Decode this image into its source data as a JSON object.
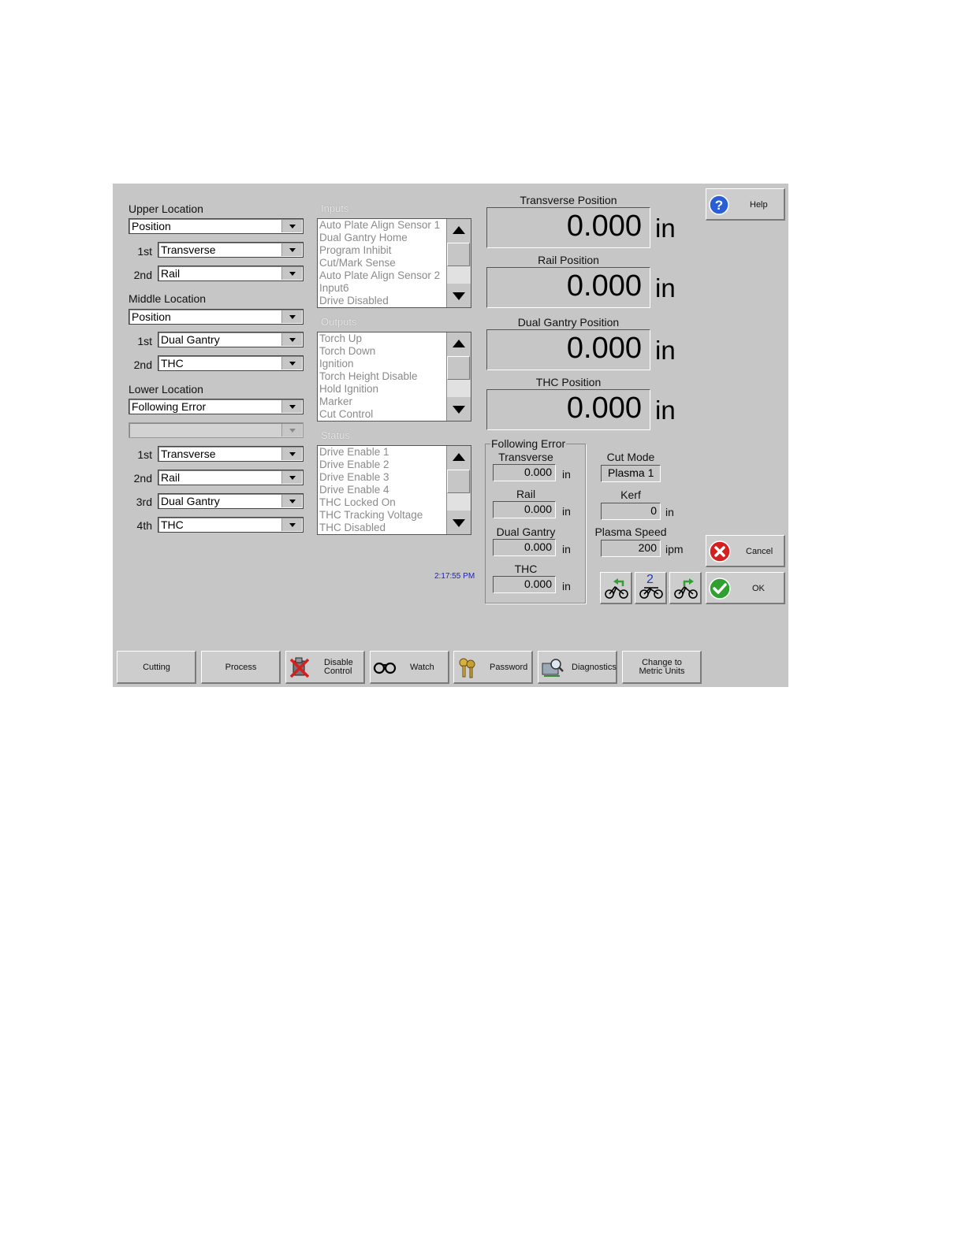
{
  "left": {
    "upper_label": "Upper Location",
    "upper_select": "Position",
    "upper_1st_label": "1st",
    "upper_1st": "Transverse",
    "upper_2nd_label": "2nd",
    "upper_2nd": "Rail",
    "middle_label": "Middle Location",
    "middle_select": "Position",
    "middle_1st_label": "1st",
    "middle_1st": "Dual Gantry",
    "middle_2nd_label": "2nd",
    "middle_2nd": "THC",
    "lower_label": "Lower Location",
    "lower_select": "Following Error",
    "lower_blank": "",
    "lower_1st_label": "1st",
    "lower_1st": "Transverse",
    "lower_2nd_label": "2nd",
    "lower_2nd": "Rail",
    "lower_3rd_label": "3rd",
    "lower_3rd": "Dual Gantry",
    "lower_4th_label": "4th",
    "lower_4th": "THC"
  },
  "inputs": {
    "label": "Inputs",
    "items": [
      "Auto Plate Align Sensor 1",
      "Dual Gantry Home",
      "Program Inhibit",
      "Cut/Mark Sense",
      "Auto Plate Align Sensor 2",
      "Input6",
      "Drive Disabled"
    ]
  },
  "outputs": {
    "label": "Outputs",
    "items": [
      "Torch Up",
      "Torch Down",
      "Ignition",
      "Torch Height Disable",
      "Hold Ignition",
      "Marker",
      "Cut Control"
    ]
  },
  "status": {
    "label": "Status",
    "items": [
      "Drive Enable 1",
      "Drive Enable 2",
      "Drive Enable 3",
      "Drive Enable 4",
      "THC Locked On",
      "THC Tracking Voltage",
      "THC Disabled"
    ]
  },
  "time": "2:17:55 PM",
  "positions": {
    "unit": "in",
    "transverse_label": "Transverse Position",
    "transverse_value": "0.000",
    "rail_label": "Rail Position",
    "rail_value": "0.000",
    "dual_label": "Dual Gantry Position",
    "dual_value": "0.000",
    "thc_label": "THC Position",
    "thc_value": "0.000"
  },
  "following_error": {
    "title": "Following Error",
    "unit": "in",
    "transverse_label": "Transverse",
    "transverse_value": "0.000",
    "rail_label": "Rail",
    "rail_value": "0.000",
    "dual_label": "Dual Gantry",
    "dual_value": "0.000",
    "thc_label": "THC",
    "thc_value": "0.000"
  },
  "cut": {
    "mode_label": "Cut Mode",
    "mode_value": "Plasma 1",
    "kerf_label": "Kerf",
    "kerf_value": "0",
    "kerf_unit": "in",
    "speed_label": "Plasma Speed",
    "speed_value": "200",
    "speed_unit": "ipm"
  },
  "buttons": {
    "help": "Help",
    "cancel": "Cancel",
    "ok": "OK",
    "mode2": "2"
  },
  "toolbar": {
    "cutting": "Cutting",
    "process": "Process",
    "disable_line1": "Disable",
    "disable_line2": "Control",
    "watch": "Watch",
    "password": "Password",
    "diagnostics": "Diagnostics",
    "metric_line1": "Change to",
    "metric_line2": "Metric Units"
  },
  "colors": {
    "panel": "#c6c6c6",
    "time_text": "#2020c0",
    "help_icon": "#2a5ed6",
    "cancel_icon": "#d42020",
    "ok_icon": "#30a030"
  }
}
